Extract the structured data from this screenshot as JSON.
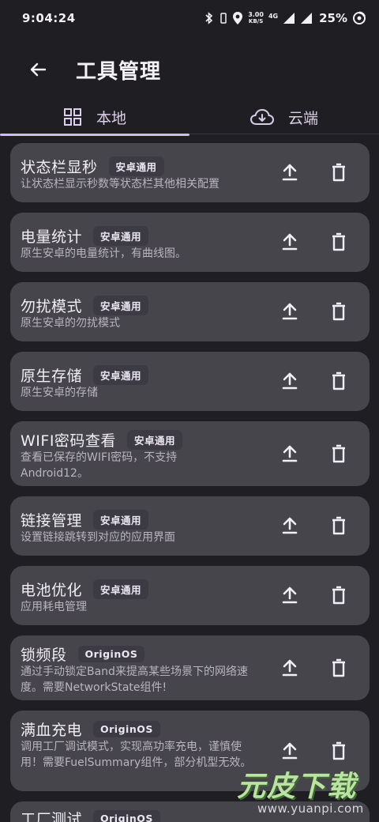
{
  "status_bar": {
    "time": "9:04:24",
    "net_speed_value": "3.00",
    "net_speed_unit": "KB/S",
    "network_type": "4G",
    "battery": "25%"
  },
  "app_bar": {
    "title": "工具管理"
  },
  "tabs": [
    {
      "label": "本地",
      "icon": "grid-icon",
      "active": true
    },
    {
      "label": "云端",
      "icon": "cloud-download-icon",
      "active": false
    }
  ],
  "tools": [
    {
      "title": "状态栏显秒",
      "badge": "安卓通用",
      "desc": "让状态栏显示秒数等状态栏其他相关配置"
    },
    {
      "title": "电量统计",
      "badge": "安卓通用",
      "desc": "原生安卓的电量统计，有曲线图。"
    },
    {
      "title": "勿扰模式",
      "badge": "安卓通用",
      "desc": "原生安卓的勿扰模式"
    },
    {
      "title": "原生存储",
      "badge": "安卓通用",
      "desc": "原生安卓的存储"
    },
    {
      "title": "WIFI密码查看",
      "badge": "安卓通用",
      "desc": "查看已保存的WIFI密码，不支持Android12。"
    },
    {
      "title": "链接管理",
      "badge": "安卓通用",
      "desc": "设置链接跳转到对应的应用界面"
    },
    {
      "title": "电池优化",
      "badge": "安卓通用",
      "desc": "应用耗电管理"
    },
    {
      "title": "锁频段",
      "badge": "OriginOS",
      "desc": "通过手动锁定Band来提高某些场景下的网络速度。需要NetworkState组件!"
    },
    {
      "title": "满血充电",
      "badge": "OriginOS",
      "desc": "调用工厂调试模式，实现高功率充电，谨慎使用！需要FuelSummary组件，部分机型无效。"
    },
    {
      "title": "工厂测试",
      "badge": "OriginOS",
      "desc": ""
    }
  ],
  "watermark": {
    "logo": "元皮下载",
    "url": "www.yuanpi.com"
  },
  "colors": {
    "background": "#1f1e23",
    "card": "#47454c",
    "badge": "#3c3a43",
    "accent": "#cdbdf0"
  }
}
